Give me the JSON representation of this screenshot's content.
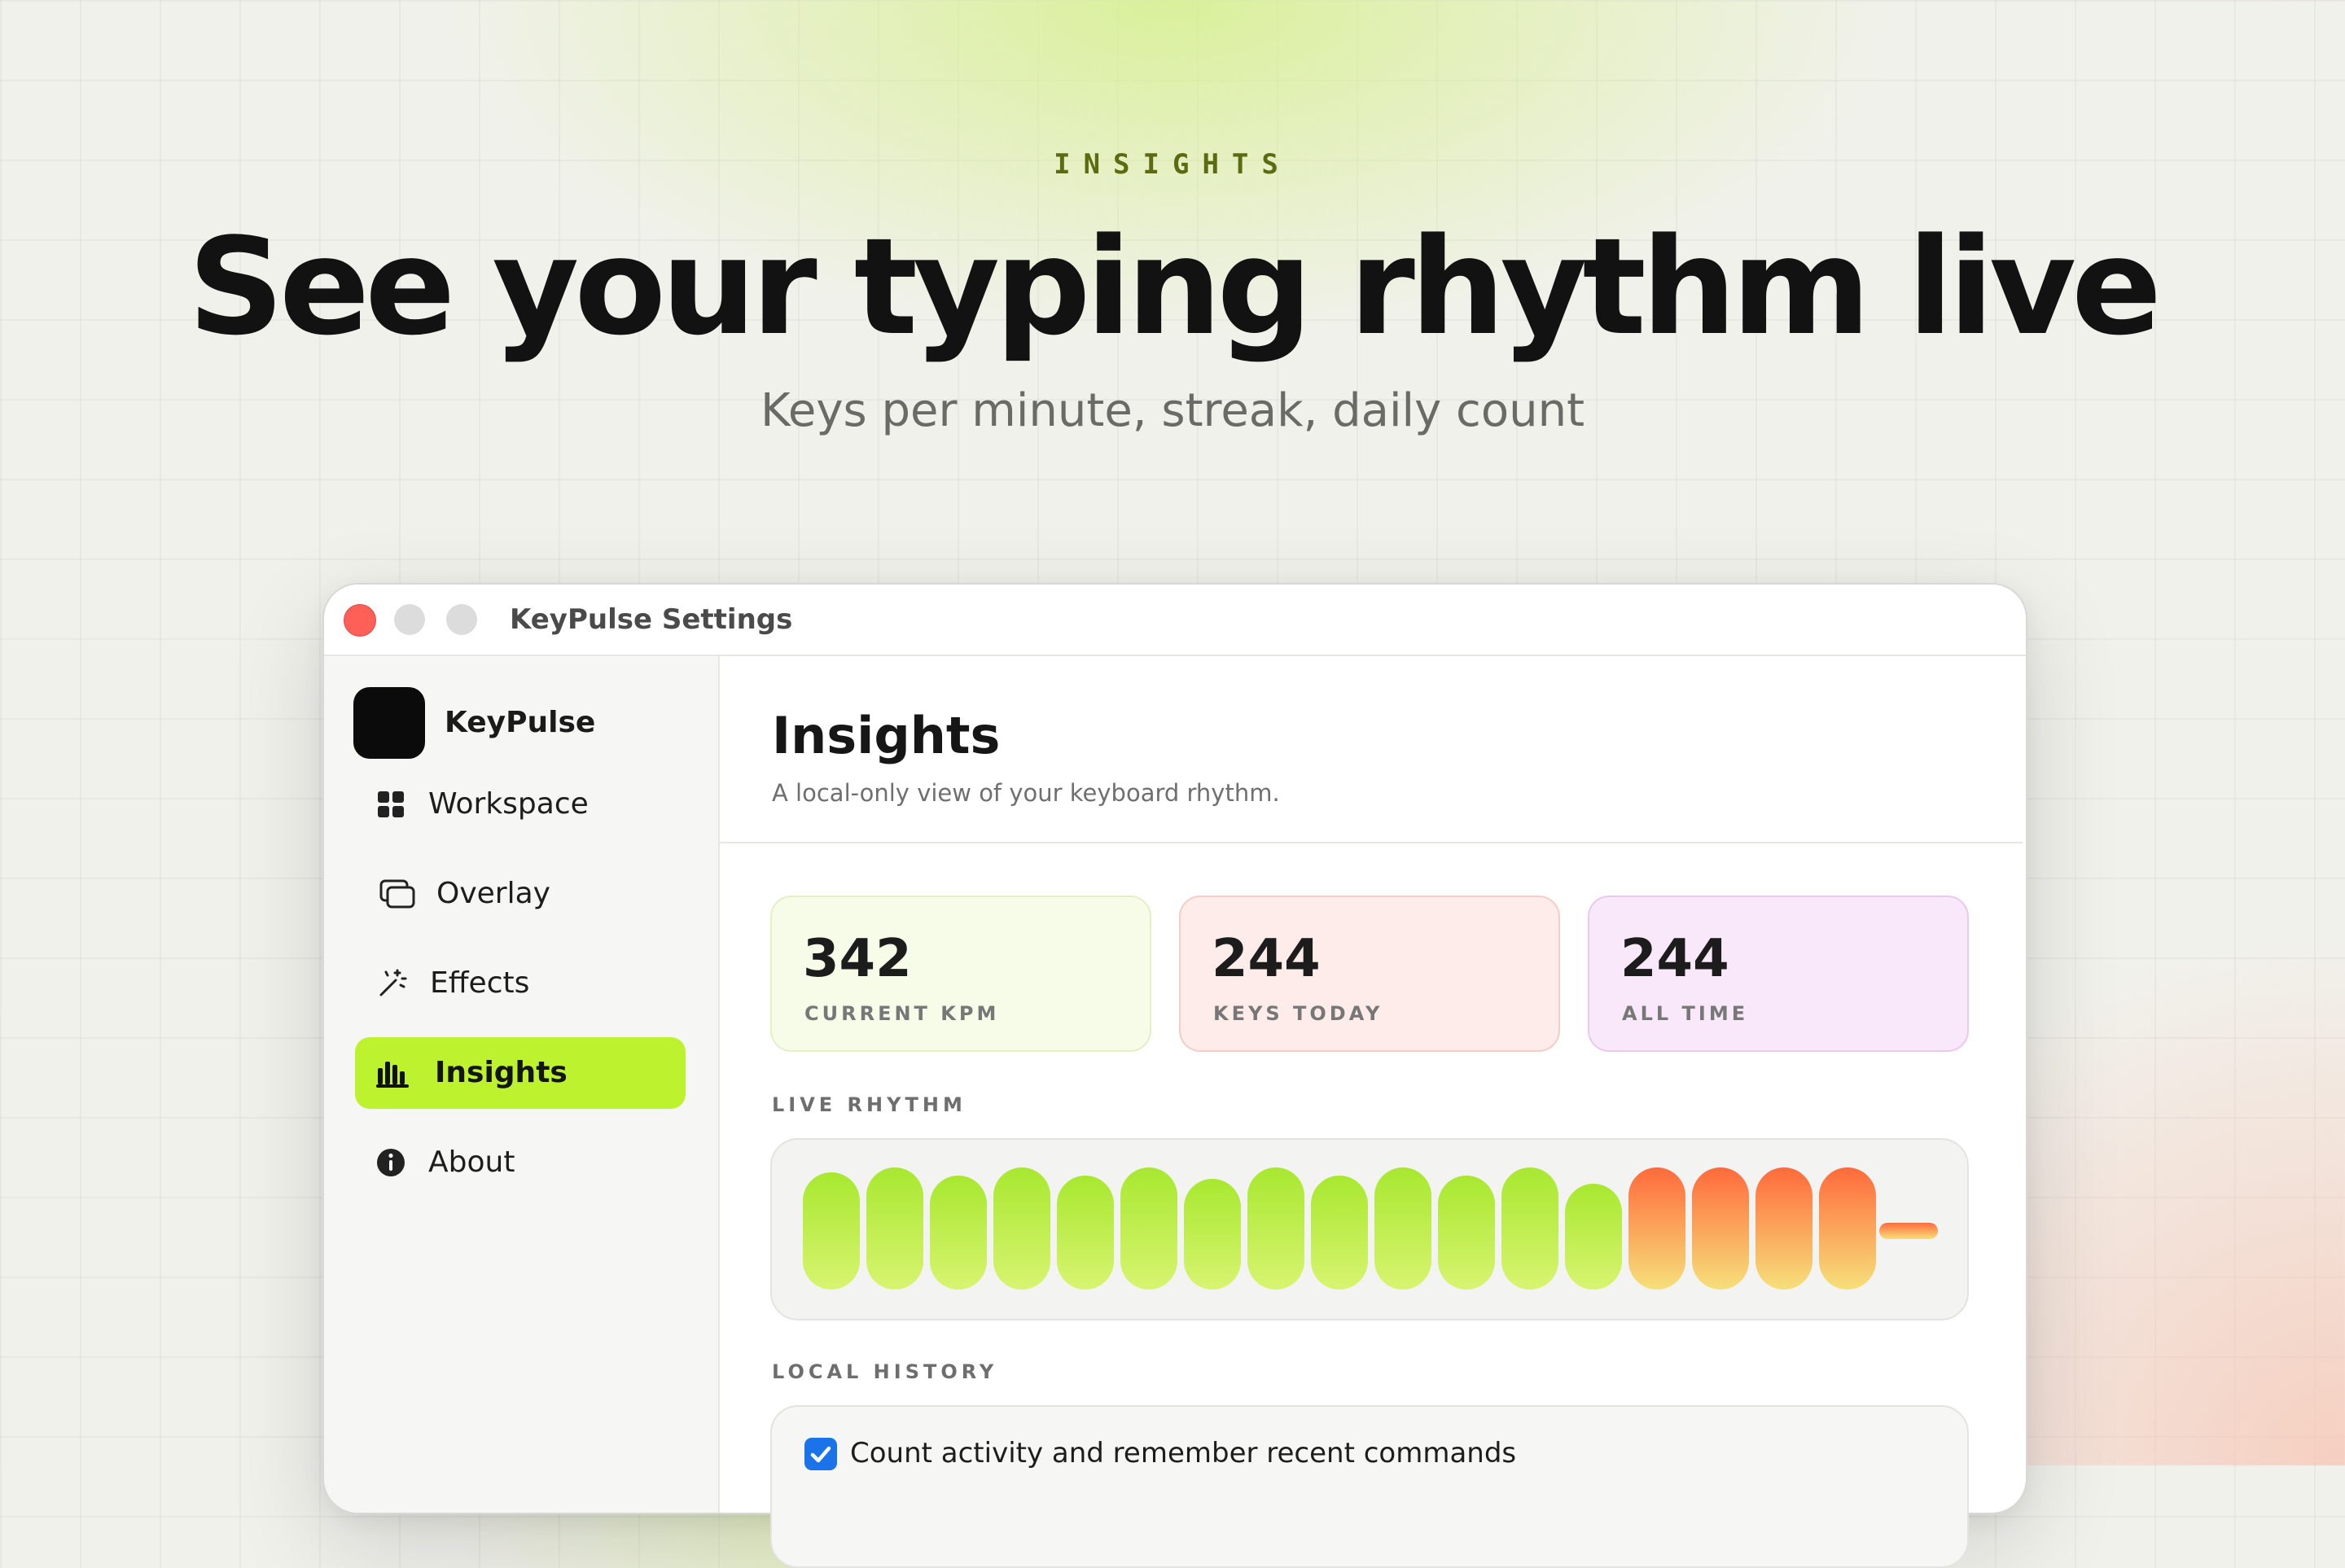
{
  "hero": {
    "eyebrow": "INSIGHTS",
    "headline": "See your typing rhythm live",
    "subline": "Keys per minute, streak, daily count"
  },
  "window": {
    "title": "KeyPulse Settings"
  },
  "sidebar": {
    "app_name": "KeyPulse",
    "items": [
      {
        "label": "Workspace",
        "icon": "grid-icon",
        "active": false
      },
      {
        "label": "Overlay",
        "icon": "overlay-icon",
        "active": false
      },
      {
        "label": "Effects",
        "icon": "magic-wand-icon",
        "active": false
      },
      {
        "label": "Insights",
        "icon": "bar-chart-icon",
        "active": true
      },
      {
        "label": "About",
        "icon": "info-icon",
        "active": false
      }
    ]
  },
  "main": {
    "title": "Insights",
    "subtitle": "A local-only view of your keyboard rhythm.",
    "stats": [
      {
        "value": "342",
        "label": "CURRENT KPM",
        "bg": "#f6fce8",
        "border": "#e4efc4"
      },
      {
        "value": "244",
        "label": "KEYS TODAY",
        "bg": "#fdecea",
        "border": "#f4cdc6"
      },
      {
        "value": "244",
        "label": "ALL TIME",
        "bg": "#f9e8f9",
        "border": "#ebc9ec"
      }
    ],
    "live_rhythm_label": "LIVE RHYTHM",
    "local_history_label": "LOCAL HISTORY",
    "history_checkbox_label": "Count activity and remember recent commands",
    "history_checkbox_checked": true
  },
  "rhythm": {
    "bars": [
      "green",
      "green",
      "green",
      "green",
      "green",
      "green",
      "green",
      "green",
      "green",
      "green",
      "green",
      "green",
      "green",
      "orange",
      "orange",
      "orange",
      "orange",
      "idle"
    ]
  },
  "colors": {
    "accent": "#bdf22e",
    "green_top": "#a8e830",
    "green_bottom": "#d8f470",
    "orange_top": "#ff6a3c",
    "orange_bottom": "#f6e07a",
    "close_button": "#fe5f57",
    "checkbox": "#1a73e8"
  }
}
